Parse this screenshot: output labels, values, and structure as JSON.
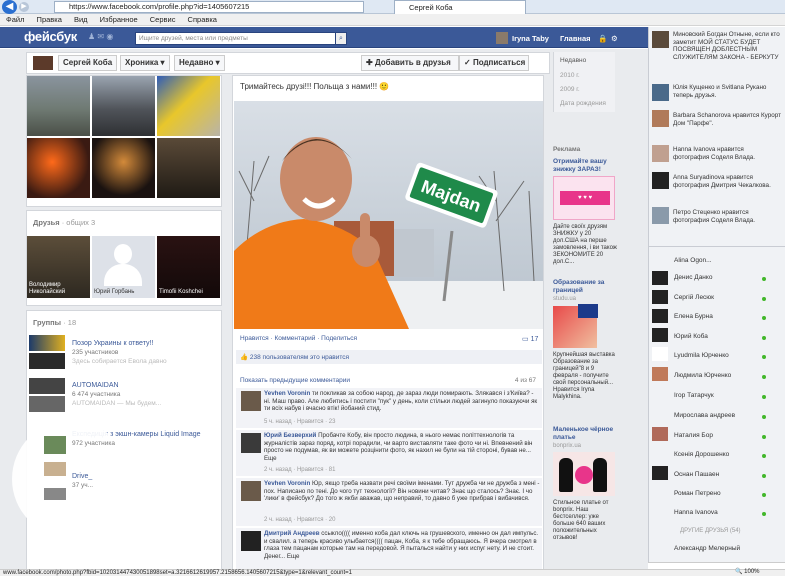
{
  "browser": {
    "url": "https://www.facebook.com/profile.php?id=1405607215",
    "tab_title": "Сергей Коба",
    "menu": [
      "Файл",
      "Правка",
      "Вид",
      "Избранное",
      "Сервис",
      "Справка"
    ],
    "status_url": "www.facebook.com/photo.php?fbid=102031447430051898set=a.3216612619957.2158656.1405607215&type=1&relevant_count=1",
    "zoom": "100%"
  },
  "fb": {
    "logo": "фейсбук",
    "search_placeholder": "Ищите друзей, места или предметы",
    "user": "Iryna Taby",
    "home": "Главная"
  },
  "profile_nav": {
    "name": "Сергей Коба",
    "timeline": "Хроника ▾",
    "recent": "Недавно ▾",
    "add_friend": "Добавить в друзья",
    "subscribe": "Подписаться"
  },
  "friends": {
    "title": "Друзья",
    "mutual": "· общих 3",
    "items": [
      "Володимир Николайский",
      "Юрий Горбань",
      "Timofii Koshchei"
    ]
  },
  "groups": {
    "title": "Группы",
    "count": "· 18",
    "items": [
      {
        "name": "Позор Украины к ответу!!",
        "meta": "235 участников",
        "sub": "Здесь собирается Евола давно"
      },
      {
        "name": "AUTOMAIDAN",
        "meta": "6 474 участника",
        "sub": "AUTOMAIDAN — Мы будем..."
      },
      {
        "name": "Експедиція з экшн-камеры Liquid Image",
        "meta": "972 участника",
        "sub": ""
      },
      {
        "name": "Drive_",
        "meta": "37 уч...",
        "sub": ""
      }
    ]
  },
  "post": {
    "text": "Тримайтесь друзі!!! Польща з нами!!! 🙂",
    "sign": "Majdan",
    "actions": "Нравится · Комментарий · Поделиться",
    "comment_count": "17",
    "likes": "238 пользователям это нравится",
    "prev_comments": "Показать предыдущие комментарии",
    "prev_count": "4 из 67",
    "comments": [
      {
        "name": "Yevhen Voronin",
        "text": "ти покликав за собою народ, де зараз люди помирають. Злякався і з'Київа? - ні. Маш право. Але любитись і постити \"пук\" у день, коли стільки людей загинуло показуючи як ти всіх набув і вчасно втік! йобаний стид.",
        "meta": "5 ч. назад · Нравится · 23"
      },
      {
        "name": "Юрий Безверхий",
        "text": "Пробачте Кобу, він просто людина, в нього немає політтехнологів та журналістів зараз поряд, котрі порадили, чи варто виставляти таке фото чи ні. Впевнений він просто не подумав, як ви можете розцінити фото, як нахил не були на тій стороні, бував не... Еще",
        "meta": "2 ч. назад · Нравится · 81"
      },
      {
        "name": "Yevhen Voronin",
        "text": "Юр, якщо треба назвати речі своїми іменами. Тут дружба чи не дружба з мені - пох. Написано по тені. До чого тут технології? Він новини читав? Знає що сталось? Знає. І чо 'лики' в фейсбук? До того ж якби аважав, що неправий, то давно б уже прибрав і вибачився.",
        "meta": "2 ч. назад · Нравится · 20"
      },
      {
        "name": "Дмитрий Андреев",
        "text": "ссыкло(((( именно коба дал ключь на грушевского, именно он дал импульс. и свалил. а теперь красиво улыбается(((( пацан, Коба, я к тебе обращаюсь. Я вчера смотрел в глаза тем пацанам которые там на передовой. Я пыталься найти у них испуг нету. И не стоит. Денег... Еще",
        "meta": ""
      }
    ]
  },
  "years": [
    "Недавно",
    "2010 г.",
    "2009 г.",
    "Дата рождения"
  ],
  "ads": {
    "title": "Реклама",
    "items": [
      {
        "title": "Отримайте вашу знижку ЗАРАЗ!",
        "text": "Дайте своїх друзям ЗНИЖКУ у 20 дол.США на перше замовлення, і ви також ЗЕКОНОМИТЕ 20 дол.С...",
        "src": ""
      },
      {
        "title": "Образование за границей",
        "text": "Крупнейшая выставка Образование за границей\"8 и 9 февраля - получите свой персональный... Нравится Iryna Malykhina.",
        "src": "studu.ua"
      },
      {
        "title": "Маленькое чёрное платье",
        "text": "Стильное платье от bonprix. Наш бестселлер: уже больше 640 ваших положительных отзывов!",
        "src": "bonprix.ua"
      }
    ]
  },
  "ticker": [
    {
      "text": "Миновский Богдан Отныне, если кто заметит МОЙ СТАТУС БУДЕТ ПОСВЯЩЕН ДОБЛЕСТНЫМ СЛУЖИТЕЛЯМ ЗАКОНА - БЕРКУТУ"
    },
    {
      "text": "Юлія Кущенко и Svitlana Рукано теперь друзья."
    },
    {
      "text": "Barbara Schanorova нравится Курорт Дом \"Парфе\"."
    },
    {
      "text": "Hanna Ivanova нравится фотография Соделя Влада."
    },
    {
      "text": "Anna Suryadinova нравится фотография Дмитрия Чекалкова."
    },
    {
      "text": "Петро Стеценко нравится фотография Соделя Влада."
    }
  ],
  "chat": {
    "first": "Alina Ogon...",
    "contacts": [
      "Денис Данко",
      "Сергій Лесюк",
      "Елена Бурна",
      "Юрий Коба",
      "Lyudmila Юрченко",
      "Людмила Юрченко",
      "Ігор Татарчук",
      "Мирослава андреев",
      "Наталия Бор",
      "Ксенія Дорошенко",
      "Оснан Пашаен",
      "Роман Петрено",
      "Hanna Ivanova"
    ],
    "more": "ДРУГИЕ ДРУЗЬЯ (54)",
    "last": "Александр Мелерный"
  }
}
